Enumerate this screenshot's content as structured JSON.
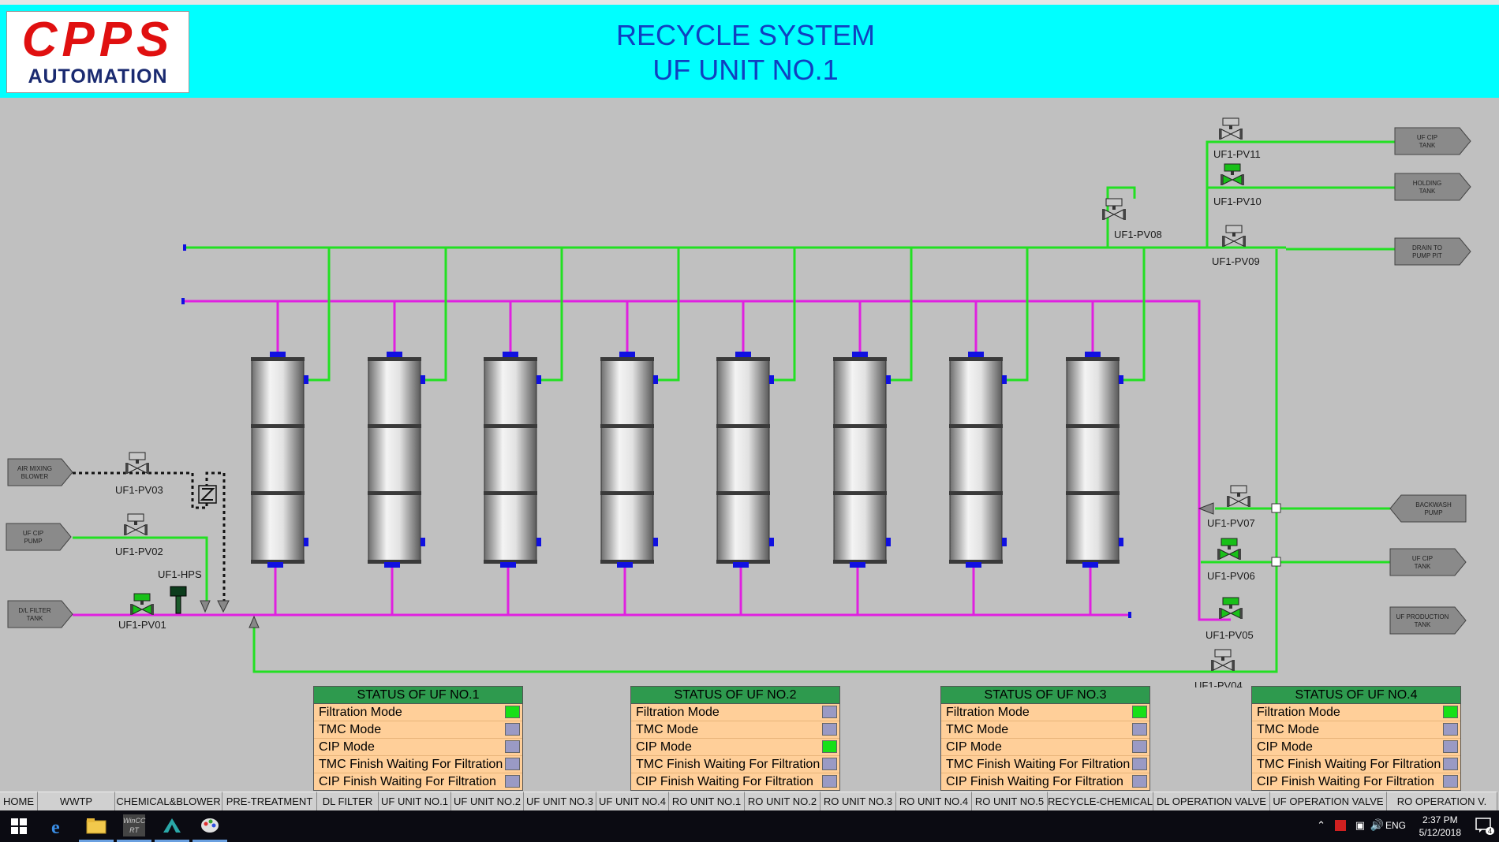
{
  "brand": {
    "line1": "CPPS",
    "line2": "AUTOMATION"
  },
  "header": {
    "title_line1": "RECYCLE SYSTEM",
    "title_line2": "UF UNIT NO.1"
  },
  "targets": {
    "left": [
      {
        "label1": "AIR MIXING",
        "label2": "BLOWER"
      },
      {
        "label1": "UF CIP",
        "label2": "PUMP"
      },
      {
        "label1": "D/L FILTER",
        "label2": "TANK"
      }
    ],
    "right": [
      {
        "label1": "UF CIP",
        "label2": "TANK"
      },
      {
        "label1": "HOLDING",
        "label2": "TANK"
      },
      {
        "label1": "DRAIN TO",
        "label2": "PUMP PIT"
      },
      {
        "label1": "BACKWASH",
        "label2": "PUMP"
      },
      {
        "label1": "UF CIP",
        "label2": "TANK"
      },
      {
        "label1": "UF PRODUCTION",
        "label2": "TANK"
      }
    ]
  },
  "valves": [
    {
      "tag": "UF1-PV01",
      "state": "open"
    },
    {
      "tag": "UF1-PV02",
      "state": "closed"
    },
    {
      "tag": "UF1-PV03",
      "state": "closed"
    },
    {
      "tag": "UF1-PV04",
      "state": "closed"
    },
    {
      "tag": "UF1-PV05",
      "state": "open"
    },
    {
      "tag": "UF1-PV06",
      "state": "open"
    },
    {
      "tag": "UF1-PV07",
      "state": "closed"
    },
    {
      "tag": "UF1-PV08",
      "state": "closed"
    },
    {
      "tag": "UF1-PV09",
      "state": "closed"
    },
    {
      "tag": "UF1-PV10",
      "state": "open"
    },
    {
      "tag": "UF1-PV11",
      "state": "closed"
    }
  ],
  "hps": {
    "tag": "UF1-HPS"
  },
  "status_panels": [
    {
      "title": "STATUS OF UF NO.1",
      "rows": [
        {
          "label": "Filtration Mode",
          "on": true
        },
        {
          "label": "TMC Mode",
          "on": false
        },
        {
          "label": "CIP Mode",
          "on": false
        },
        {
          "label": "TMC Finish Waiting For Filtration",
          "on": false
        },
        {
          "label": "CIP Finish Waiting For Filtration",
          "on": false
        }
      ]
    },
    {
      "title": "STATUS OF UF NO.2",
      "rows": [
        {
          "label": "Filtration Mode",
          "on": false
        },
        {
          "label": "TMC Mode",
          "on": false
        },
        {
          "label": "CIP Mode",
          "on": true
        },
        {
          "label": "TMC Finish Waiting For Filtration",
          "on": false
        },
        {
          "label": "CIP Finish Waiting For Filtration",
          "on": false
        }
      ]
    },
    {
      "title": "STATUS OF UF NO.3",
      "rows": [
        {
          "label": "Filtration Mode",
          "on": true
        },
        {
          "label": "TMC Mode",
          "on": false
        },
        {
          "label": "CIP Mode",
          "on": false
        },
        {
          "label": "TMC Finish Waiting For Filtration",
          "on": false
        },
        {
          "label": "CIP Finish Waiting For Filtration",
          "on": false
        }
      ]
    },
    {
      "title": "STATUS OF UF NO.4",
      "rows": [
        {
          "label": "Filtration Mode",
          "on": true
        },
        {
          "label": "TMC Mode",
          "on": false
        },
        {
          "label": "CIP Mode",
          "on": false
        },
        {
          "label": "TMC Finish Waiting For Filtration",
          "on": false
        },
        {
          "label": "CIP Finish Waiting For Filtration",
          "on": false
        }
      ]
    }
  ],
  "nav": [
    "HOME",
    "WWTP",
    "CHEMICAL&BLOWER",
    "PRE-TREATMENT",
    "DL FILTER",
    "UF UNIT NO.1",
    "UF UNIT NO.2",
    "UF UNIT NO.3",
    "UF UNIT NO.4",
    "RO UNIT NO.1",
    "RO UNIT NO.2",
    "RO UNIT NO.3",
    "RO UNIT NO.4",
    "RO UNIT NO.5",
    "RECYCLE-CHEMICAL",
    "DL OPERATION VALVE",
    "UF OPERATION VALVE",
    "RO OPERATION V."
  ],
  "taskbar": {
    "icons": [
      "windows-start-icon",
      "internet-explorer-icon",
      "file-explorer-icon",
      "wincc-rt-icon",
      "tia-portal-icon",
      "paint-icon"
    ],
    "wincc_label": "WinCC RT",
    "language": "ENG",
    "time": "2:37 PM",
    "date": "5/12/2018",
    "notifications": "4"
  },
  "colors": {
    "header_bg": "#00ffff",
    "process_bg": "#c0c0c0",
    "green_line": "#22e022",
    "magenta_line": "#e020e0",
    "status_header": "#2e9a4e",
    "status_row": "#ffcf99",
    "indicator_on": "#18e018",
    "indicator_off": "#9a9ac4",
    "title_blue": "#1040c0",
    "logo_red": "#e01010"
  }
}
